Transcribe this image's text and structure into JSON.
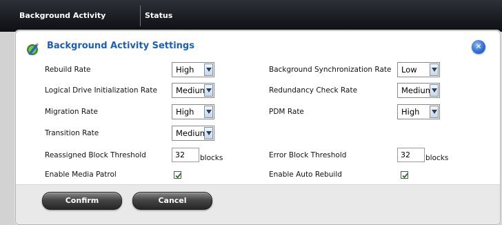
{
  "topbar": {
    "tabs": [
      {
        "label": "Background Activity"
      },
      {
        "label": "Status"
      }
    ]
  },
  "panel": {
    "title": "Background Activity Settings",
    "close_icon": "close-icon"
  },
  "settings": {
    "rebuild_rate": {
      "label": "Rebuild Rate",
      "value": "High"
    },
    "background_sync_rate": {
      "label": "Background Synchronization Rate",
      "value": "Low"
    },
    "logical_drive_init_rate": {
      "label": "Logical Drive Initialization Rate",
      "value": "Medium"
    },
    "redundancy_check_rate": {
      "label": "Redundancy Check Rate",
      "value": "Medium"
    },
    "migration_rate": {
      "label": "Migration Rate",
      "value": "High"
    },
    "pdm_rate": {
      "label": "PDM Rate",
      "value": "High"
    },
    "transition_rate": {
      "label": "Transition Rate",
      "value": "Medium"
    },
    "reassigned_block_threshold": {
      "label": "Reassigned Block Threshold",
      "value": "32",
      "unit": "blocks"
    },
    "error_block_threshold": {
      "label": "Error Block Threshold",
      "value": "32",
      "unit": "blocks"
    },
    "enable_media_patrol": {
      "label": "Enable Media Patrol",
      "checked": true
    },
    "enable_auto_rebuild": {
      "label": "Enable Auto Rebuild",
      "checked": true
    }
  },
  "footer": {
    "confirm_label": "Confirm",
    "cancel_label": "Cancel"
  },
  "colors": {
    "accent": "#1a5dc4",
    "topbar": "#1a1c21"
  }
}
